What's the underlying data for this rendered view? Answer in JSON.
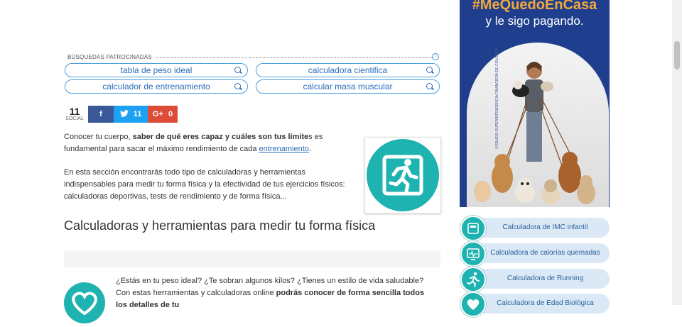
{
  "sponsored": {
    "label": "BÚSQUEDAS PATROCINADAS",
    "info_icon": "info-icon",
    "items": [
      {
        "label": "tabla de peso ideal",
        "icon": "search-icon"
      },
      {
        "label": "calculadora cientifica",
        "icon": "search-icon"
      },
      {
        "label": "calculador de entrenamiento",
        "icon": "search-icon"
      },
      {
        "label": "calcular masa muscular",
        "icon": "search-icon"
      }
    ]
  },
  "social": {
    "count": "11",
    "count_label": "SOCIAL",
    "facebook": {
      "label": "f",
      "icon": "facebook-icon"
    },
    "twitter": {
      "count": "11",
      "icon": "twitter-icon"
    },
    "google_plus": {
      "count": "0",
      "icon": "google-plus-icon"
    }
  },
  "intro": {
    "p1_a": "Conocer tu cuerpo, ",
    "p1_bold": "saber de qué eres capaz y cuáles son tus límite",
    "p1_b": "s es fundamental para sacar el máximo rendimiento de cada ",
    "p1_link": "entrenamiento",
    "p1_end": ".",
    "p2": "En esta sección encontrarás todo tipo de calculadoras y herramientas indispensables para medir tu forma física y la efectividad de tus ejercicios físicos: calculadoras deportivas, tests de rendimiento y de forma física..."
  },
  "section_title": "Calculadoras y herramientas para medir tu forma física",
  "para2": {
    "a": "¿Estás en tu peso ideal? ¿Te sobran algunos kilos? ¿Tienes un estilo de vida saludable? Con estas herramientas y calculadoras online ",
    "bold": "podrás conocer de forma sencilla todos los detalles de tu"
  },
  "ad": {
    "hashtag": "#MeQuedoEnCasa",
    "subtitle": "y le sigo pagando.",
    "legal": "VIGILADO SUPERINTENDENCIA FINANCIERA DE COLOMBIA"
  },
  "calculators": [
    {
      "label": "Calculadora de IMC infantil",
      "icon": "scale-icon"
    },
    {
      "label": "Calculadora de calorías quemadas",
      "icon": "monitor-icon"
    },
    {
      "label": "Calculadora de Running",
      "icon": "runner-icon"
    },
    {
      "label": "Calculadora de Edad Biológica",
      "icon": "heart-icon"
    }
  ],
  "colors": {
    "teal": "#1eb3b0",
    "pill_border": "#4a9fe0",
    "facebook": "#3b5998",
    "twitter": "#1da1f2",
    "google_plus": "#dd4b39",
    "ad_bg": "#1f3f8e",
    "ad_hashtag": "#f3a838"
  }
}
